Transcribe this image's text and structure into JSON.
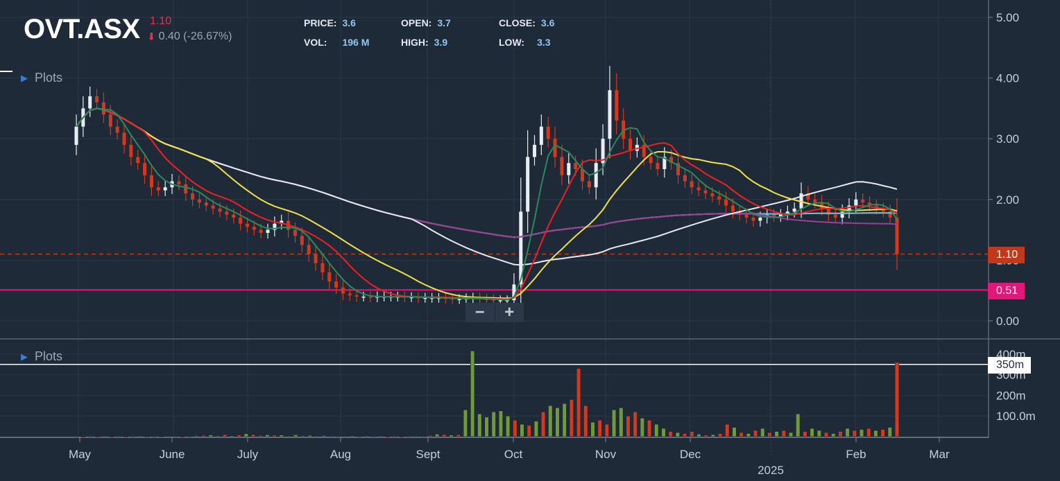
{
  "header": {
    "ticker": "OVT.ASX",
    "last_price": "1.10",
    "change_text": "0.40 (-26.67%)",
    "stats": [
      {
        "label": "PRICE:",
        "value": "3.6"
      },
      {
        "label": "OPEN:",
        "value": "3.7"
      },
      {
        "label": "CLOSE:",
        "value": "3.6"
      },
      {
        "label": "VOL:",
        "value": "196 M"
      },
      {
        "label": "HIGH:",
        "value": "3.9"
      },
      {
        "label": "LOW:",
        "value": "3.3"
      }
    ]
  },
  "plots_label_top": "Plots",
  "plots_label_bottom": "Plots",
  "zoom": {
    "minus": "−",
    "plus": "+"
  },
  "colors": {
    "background": "#1f2a38",
    "up": "#6e9a3a",
    "down": "#d23a1f",
    "white_candle": "#e8edf2",
    "price_line": "#c0391b",
    "support_line": "#e0187a",
    "ma_white": "#e8eaee",
    "ma_blue": "#72b9dd",
    "ma_orange": "#e07f2c",
    "ma_purple": "#9a3f9a",
    "ma_yellow": "#f0e14a",
    "ma_red": "#f02020",
    "ma_green": "#2a8a5a"
  },
  "chart_data": [
    {
      "type": "candlestick",
      "title": "OVT.ASX",
      "x_ticks": [
        "May",
        "June",
        "July",
        "Aug",
        "Sept",
        "Oct",
        "Nov",
        "Dec",
        "Feb",
        "Mar"
      ],
      "x_sub_label": "2025",
      "y_ticks": [
        "0.00",
        "1.00",
        "2.00",
        "3.00",
        "4.00",
        "5.00"
      ],
      "ylim": [
        0,
        5.3
      ],
      "price_line": {
        "value": 1.1,
        "label": "1.10",
        "style": "dashed"
      },
      "support_line": {
        "value": 0.51,
        "label": "0.51"
      },
      "close_series": [
        3.2,
        3.5,
        3.7,
        3.6,
        3.4,
        3.2,
        3.1,
        2.9,
        2.7,
        2.6,
        2.4,
        2.2,
        2.15,
        2.2,
        2.3,
        2.25,
        2.1,
        2.0,
        1.95,
        1.9,
        1.85,
        1.8,
        1.75,
        1.7,
        1.6,
        1.55,
        1.5,
        1.45,
        1.5,
        1.6,
        1.65,
        1.5,
        1.4,
        1.25,
        1.1,
        0.95,
        0.8,
        0.65,
        0.55,
        0.45,
        0.42,
        0.4,
        0.4,
        0.39,
        0.4,
        0.4,
        0.4,
        0.4,
        0.39,
        0.39,
        0.38,
        0.38,
        0.38,
        0.38,
        0.37,
        0.36,
        0.36,
        0.37,
        0.38,
        0.36,
        0.35,
        0.34,
        0.34,
        0.34,
        0.6,
        1.8,
        2.7,
        2.9,
        3.2,
        3.0,
        2.7,
        2.4,
        2.6,
        2.5,
        2.3,
        2.2,
        2.6,
        3.0,
        3.8,
        3.3,
        3.0,
        2.8,
        2.9,
        2.7,
        2.6,
        2.5,
        2.7,
        2.6,
        2.4,
        2.3,
        2.2,
        2.15,
        2.1,
        2.05,
        2.0,
        1.9,
        1.8,
        1.75,
        1.7,
        1.65,
        1.7,
        1.75,
        1.72,
        1.75,
        1.8,
        1.85,
        2.1,
        2.0,
        1.95,
        1.85,
        1.75,
        1.7,
        1.8,
        1.9,
        2.0,
        1.95,
        1.9,
        1.85,
        1.8,
        1.7,
        1.1
      ],
      "moving_averages": [
        {
          "color": "ma_green",
          "period": 5
        },
        {
          "color": "ma_red",
          "period": 10
        },
        {
          "color": "ma_yellow",
          "period": 20
        },
        {
          "color": "ma_white",
          "period": 50
        },
        {
          "color": "ma_purple",
          "period": 100
        },
        {
          "color": "ma_blue",
          "period": 150
        },
        {
          "color": "ma_orange",
          "period": 200
        }
      ]
    },
    {
      "type": "bar",
      "title": "Volume",
      "y_ticks": [
        "100.0m",
        "200m",
        "300m",
        "400m"
      ],
      "ylim": [
        0,
        430
      ],
      "marker_line": {
        "value": 350,
        "label": "350m"
      },
      "values": [
        2,
        1,
        2,
        1,
        3,
        1,
        2,
        1,
        2,
        4,
        1,
        2,
        1,
        3,
        2,
        1,
        2,
        4,
        6,
        8,
        5,
        10,
        4,
        8,
        14,
        10,
        6,
        9,
        7,
        8,
        4,
        9,
        5,
        6,
        4,
        5,
        3,
        2,
        3,
        4,
        2,
        3,
        2,
        3,
        1,
        2,
        1,
        2,
        3,
        2,
        6,
        12,
        10,
        8,
        9,
        130,
        415,
        110,
        95,
        120,
        125,
        100,
        80,
        60,
        55,
        75,
        120,
        150,
        140,
        160,
        180,
        330,
        150,
        70,
        80,
        60,
        130,
        140,
        100,
        120,
        90,
        80,
        60,
        40,
        25,
        20,
        15,
        25,
        12,
        8,
        10,
        15,
        60,
        45,
        20,
        15,
        30,
        40,
        20,
        25,
        30,
        20,
        110,
        25,
        40,
        30,
        20,
        15,
        25,
        40,
        30,
        35,
        40,
        30,
        35,
        45,
        360
      ],
      "up_flags": [
        1,
        0,
        1,
        0,
        1,
        0,
        1,
        0,
        1,
        0,
        1,
        0,
        1,
        0,
        1,
        0,
        0,
        1,
        0,
        1,
        0,
        0,
        1,
        0,
        1,
        0,
        0,
        1,
        0,
        1,
        0,
        1,
        0,
        1,
        0,
        1,
        0,
        1,
        0,
        1,
        0,
        1,
        0,
        1,
        0,
        1,
        0,
        1,
        0,
        1,
        0,
        1,
        0,
        1,
        0,
        1,
        1,
        1,
        1,
        1,
        1,
        1,
        0,
        1,
        0,
        1,
        0,
        1,
        1,
        1,
        0,
        0,
        0,
        1,
        0,
        0,
        1,
        1,
        0,
        0,
        1,
        0,
        1,
        1,
        0,
        1,
        0,
        0,
        1,
        0,
        1,
        0,
        0,
        1,
        0,
        1,
        0,
        1,
        0,
        1,
        0,
        1,
        1,
        0,
        1,
        1,
        0,
        1,
        0,
        1,
        0,
        1,
        0,
        1,
        0,
        1,
        0
      ]
    }
  ]
}
